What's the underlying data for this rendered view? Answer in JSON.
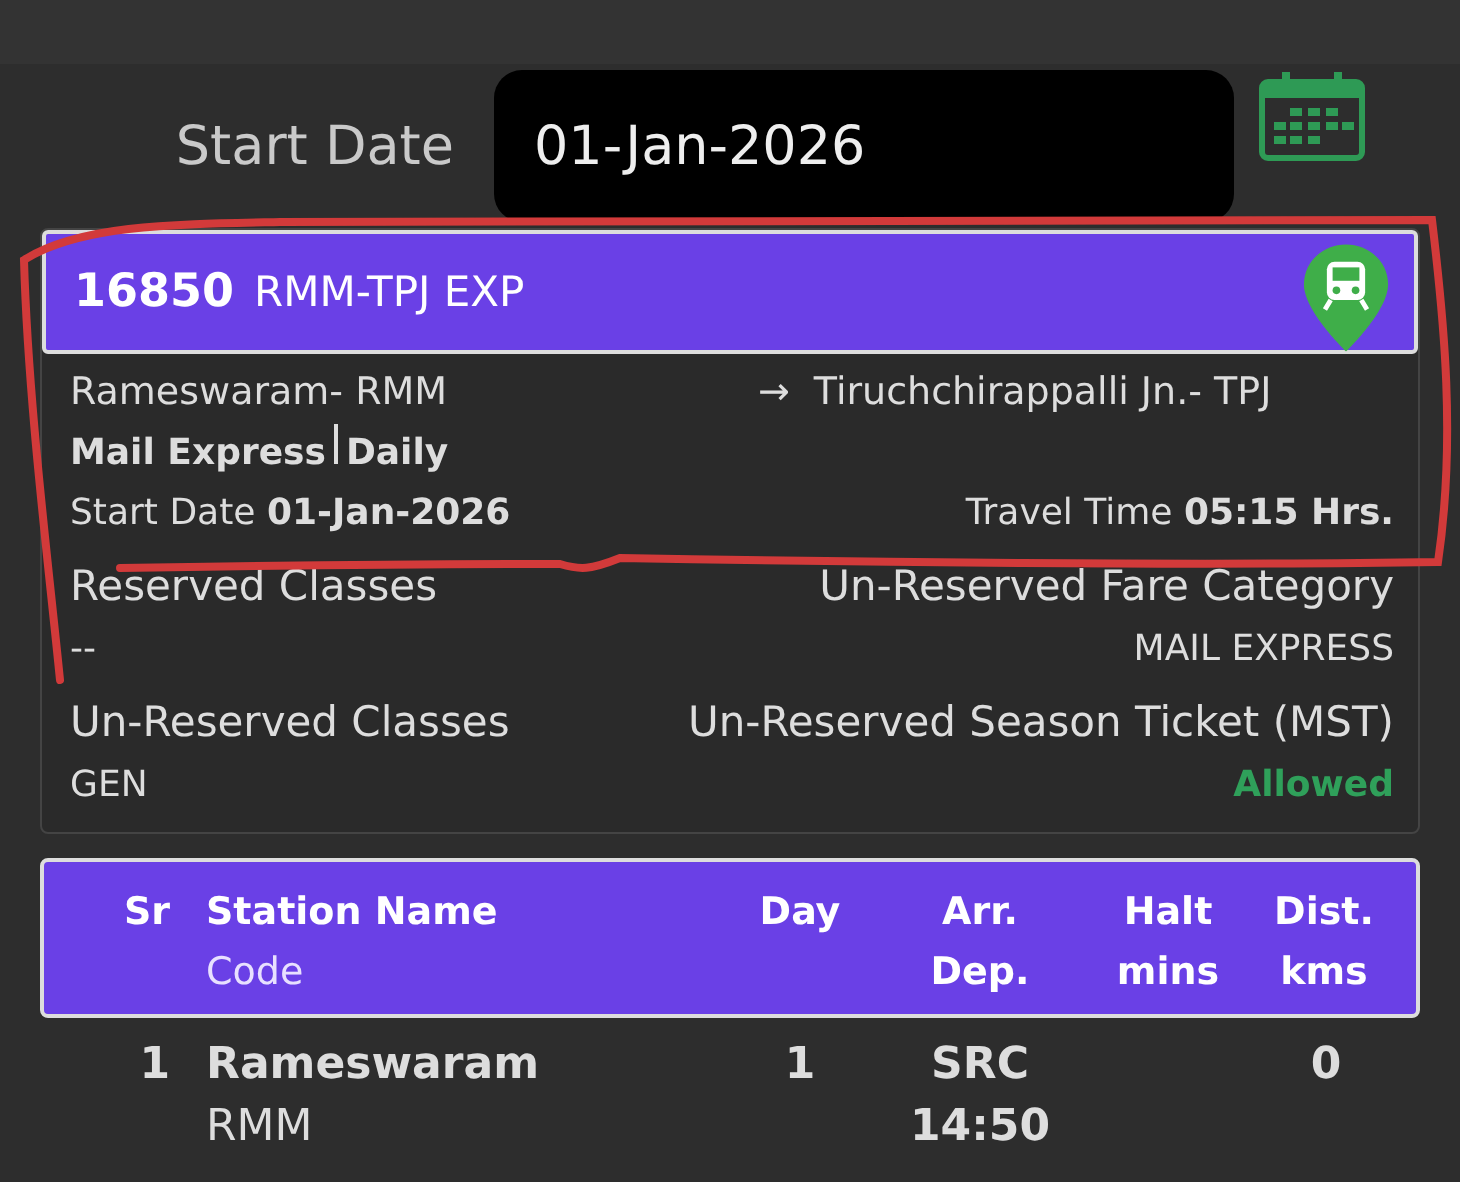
{
  "search": {
    "label": "Start Date",
    "value": "01-Jan-2026"
  },
  "train": {
    "number": "16850",
    "name": "RMM-TPJ EXP",
    "from": "Rameswaram- RMM",
    "arrow": "→",
    "to": "Tiruchchirappalli Jn.- TPJ",
    "type": "Mail Express",
    "days": "Daily",
    "start_label": "Start Date",
    "start_date": "01-Jan-2026",
    "travel_label": "Travel Time",
    "travel_time": "05:15 Hrs.",
    "reserved_label": "Reserved Classes",
    "reserved_value": "--",
    "fare_label": "Un-Reserved Fare Category",
    "fare_value": "MAIL EXPRESS",
    "unreserved_label": "Un-Reserved Classes",
    "unreserved_value": "GEN",
    "season_label": "Un-Reserved Season Ticket (MST)",
    "season_value": "Allowed",
    "season_allowed": true
  },
  "table": {
    "columns": [
      {
        "top": "Sr"
      },
      {
        "top": "Station Name",
        "bottom": "Code"
      },
      {
        "top": "Day"
      },
      {
        "top": "Arr.",
        "bottom": "Dep."
      },
      {
        "top": "Halt",
        "bottom": "mins"
      },
      {
        "top": "Dist.",
        "bottom": "kms"
      }
    ],
    "rows": [
      {
        "sr": "1",
        "station": "Rameswaram",
        "code": "RMM",
        "day": "1",
        "arr": "SRC",
        "dep": "14:50",
        "dist": "0"
      }
    ]
  },
  "annotation": {
    "kind": "freehand"
  }
}
